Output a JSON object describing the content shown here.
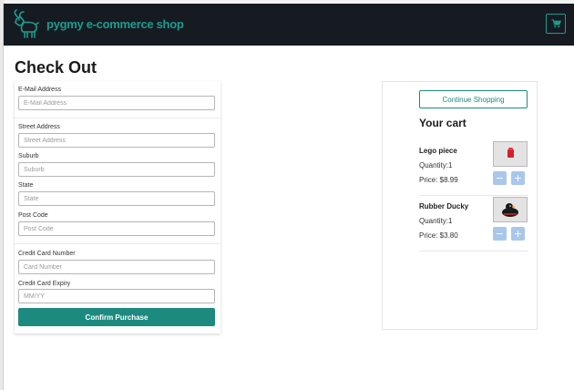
{
  "header": {
    "brand_name": "pygmy e-commerce shop",
    "logo_icon": "goat-logo-icon",
    "cart_icon": "shopping-cart-icon"
  },
  "page": {
    "title": "Check Out"
  },
  "form": {
    "email": {
      "label": "E-Mail Address",
      "placeholder": "E-Mail Address",
      "value": ""
    },
    "street": {
      "label": "Street Address",
      "placeholder": "Street Address",
      "value": ""
    },
    "suburb": {
      "label": "Suburb",
      "placeholder": "Suburb",
      "value": ""
    },
    "state": {
      "label": "State",
      "placeholder": "State",
      "value": ""
    },
    "postcode": {
      "label": "Post Code",
      "placeholder": "Post Code",
      "value": ""
    },
    "card_number": {
      "label": "Credit Card Number",
      "placeholder": "Card Number",
      "value": ""
    },
    "card_expiry": {
      "label": "Credit Card Expiry",
      "placeholder": "MM/YY",
      "value": ""
    },
    "confirm_label": "Confirm Purchase"
  },
  "cart": {
    "continue_label": "Continue Shopping",
    "heading": "Your cart",
    "items": [
      {
        "name": "Lego piece",
        "quantity": "Quantity:1",
        "price": "Price: $8.99",
        "minus": "−",
        "plus": "+"
      },
      {
        "name": "Rubber Ducky",
        "quantity": "Quantity:1",
        "price": "Price: $3.80",
        "minus": "−",
        "plus": "+"
      }
    ]
  },
  "colors": {
    "brand": "#1d9c8f",
    "navbar_bg": "#161b22",
    "primary_button": "#1d8a80",
    "qty_button": "#a9c7eb"
  }
}
